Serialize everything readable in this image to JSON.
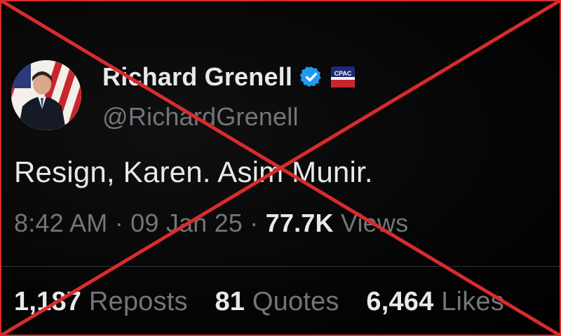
{
  "author": {
    "display_name": "Richard Grenell",
    "handle": "@RichardGrenell",
    "verified_icon": "verified-badge-icon",
    "affiliation_icon": "cpac-badge-icon",
    "affiliation_text": "CPAC"
  },
  "tweet": {
    "text": "Resign, Karen. Asim Munir."
  },
  "meta": {
    "time": "8:42 AM",
    "date": "09 Jan 25",
    "views_count": "77.7K",
    "views_label": "Views",
    "separator": "·"
  },
  "stats": {
    "reposts_count": "1,187",
    "reposts_label": "Reposts",
    "quotes_count": "81",
    "quotes_label": "Quotes",
    "likes_count": "6,464",
    "likes_label": "Likes"
  },
  "overlay": {
    "cross_color": "#d92b2b",
    "cross_icon": "red-x-overlay"
  },
  "colors": {
    "background": "#000000",
    "primary_text": "#e7e9ea",
    "secondary_text": "#71767b",
    "verified_blue": "#1d9bf0"
  }
}
